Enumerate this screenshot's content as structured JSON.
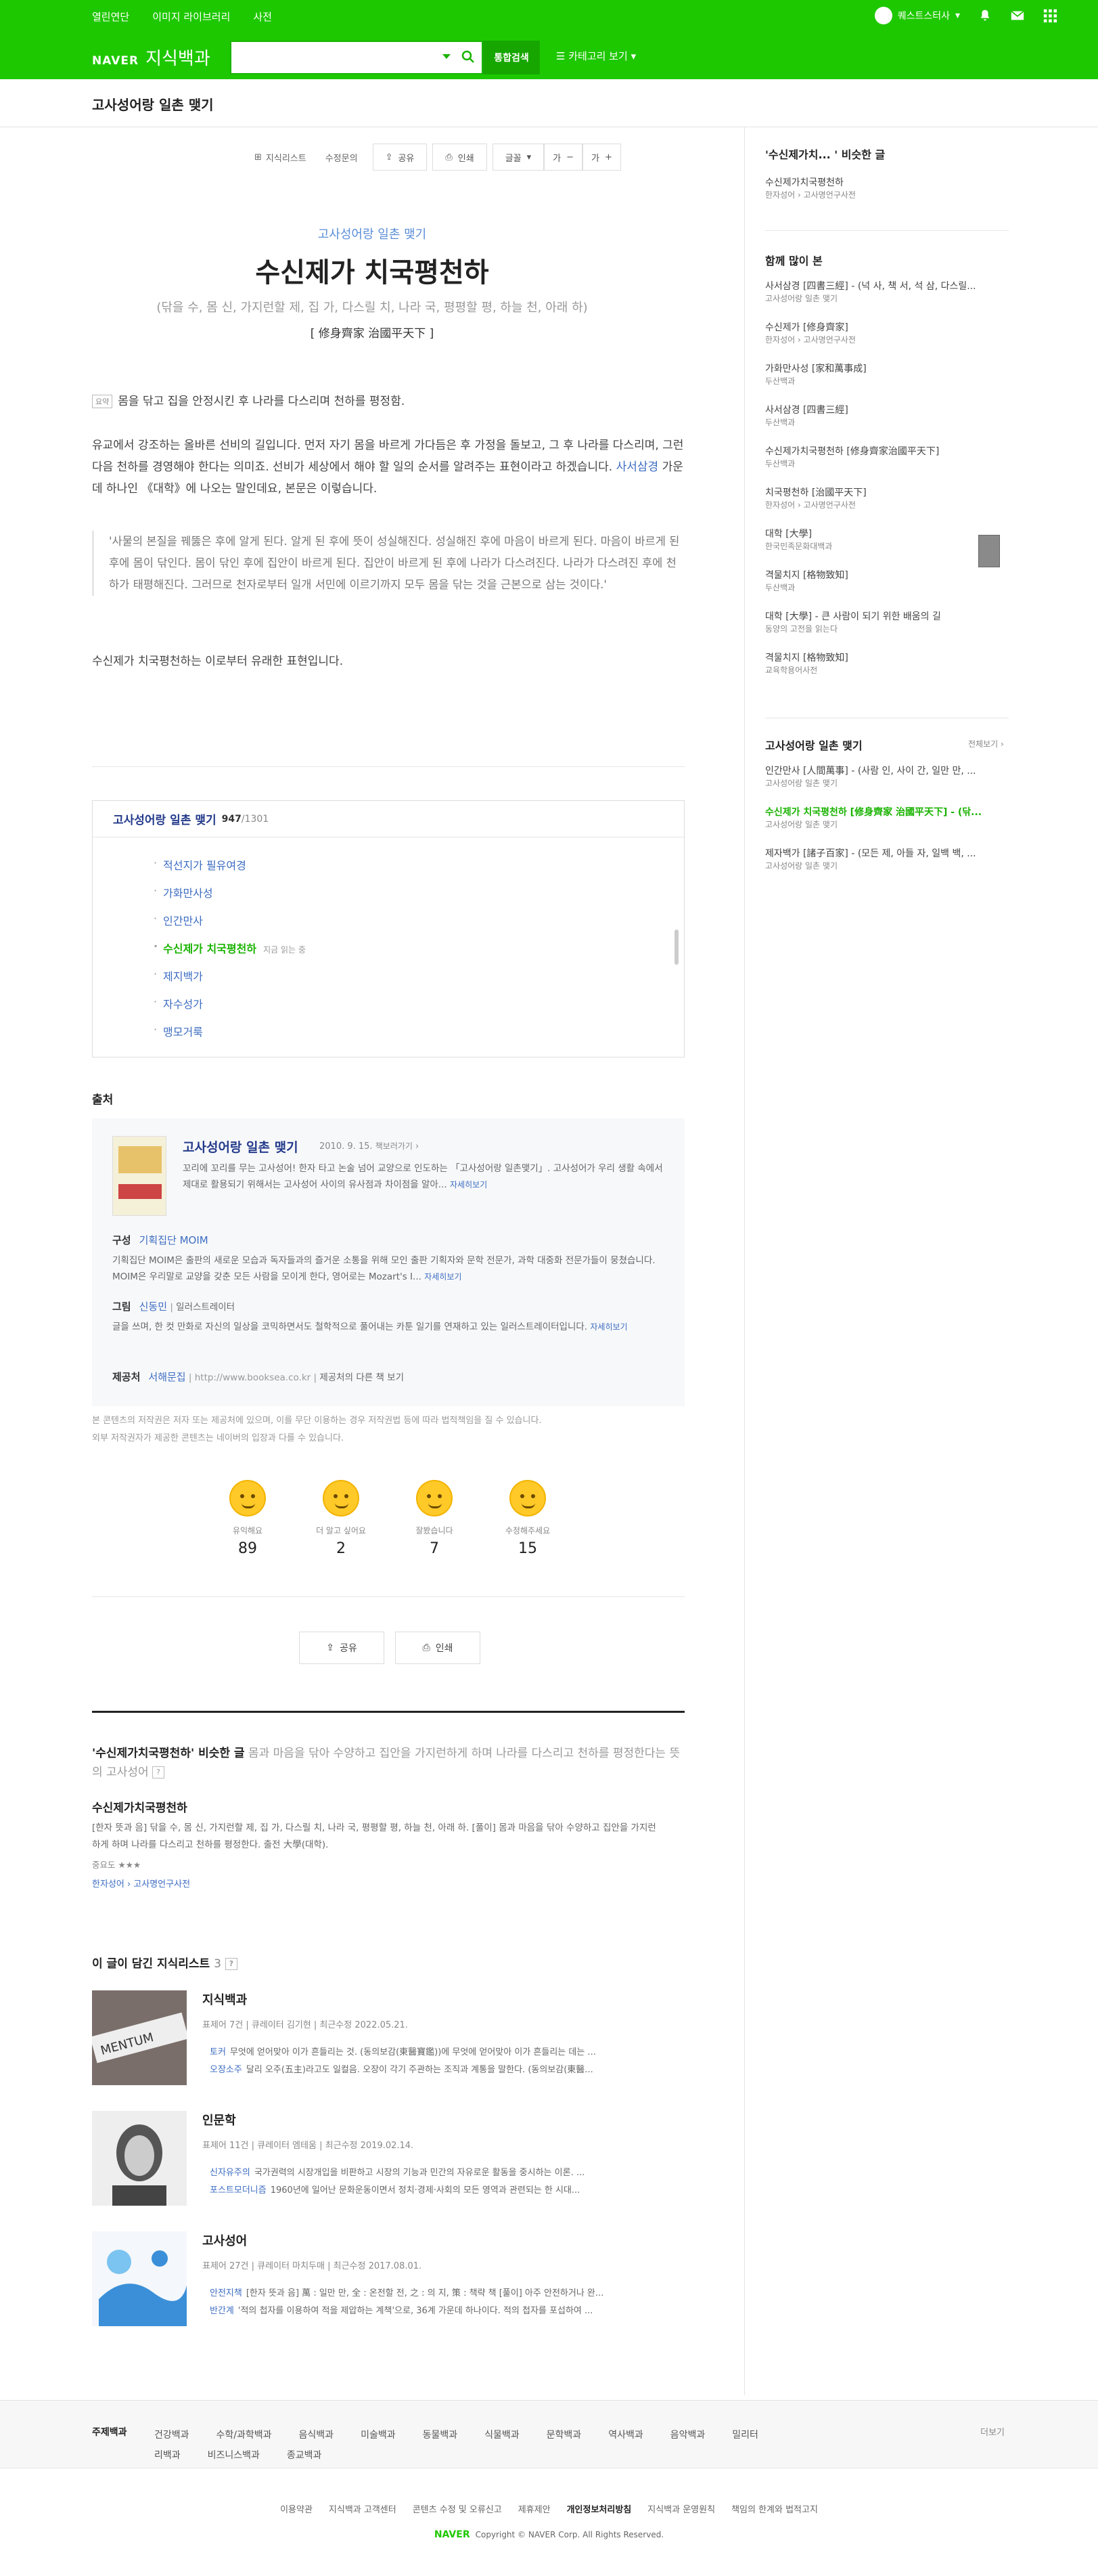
{
  "gnb": {
    "links": [
      "열린연단",
      "이미지 라이브러리",
      "사전"
    ],
    "user": "퀘스트스터사",
    "logo": "NAVER",
    "service": "지식백과",
    "search_btn": "통합검색",
    "category_btn": "카테고리 보기"
  },
  "page_title": "고사성어랑 일촌 맺기",
  "tools": {
    "knowledge_list": "지식리스트",
    "edit_request": "수정문의",
    "share": "공유",
    "print": "인쇄",
    "font": "글꼴",
    "font_small": "가",
    "font_large": "가"
  },
  "article": {
    "category": "고사성어랑 일촌 맺기",
    "headword": "수신제가 치국평천하",
    "reading": "(닦을 수, 몸 신, 가지런할 제, 집 가, 다스릴 치, 나라 국, 평평할 평, 하늘 천, 아래 하)",
    "hanja": "[ 修身齊家 治國平天下 ]",
    "summary_tag": "요약",
    "summary": "몸을 닦고 집을 안정시킨 후 나라를 다스리며 천하를 평정함.",
    "para1_a": "유교에서 강조하는 올바른 선비의 길입니다. 먼저 자기 몸을 바르게 가다듬은 후 가정을 돌보고, 그 후 나라를 다스리며, 그런 다음 천하를 경영해야 한다는 의미죠. 선비가 세상에서 해야 할 일의 순서를 알려주는 표현이라고 하겠습니다.",
    "para1_link": "사서삼경",
    "para1_b": " 가운데 하나인 《대학》에 나오는 말인데요, 본문은 이렇습니다.",
    "quote": "'사물의 본질을 꿰뚫은 후에 알게 된다. 알게 된 후에 뜻이 성실해진다. 성실해진 후에 마음이 바르게 된다. 마음이 바르게 된 후에 몸이 닦인다. 몸이 닦인 후에 집안이 바르게 된다. 집안이 바르게 된 후에 나라가 다스려진다. 나라가 다스려진 후에 천하가 태평해진다. 그러므로 천자로부터 일개 서민에 이르기까지 모두 몸을 닦는 것을 근본으로 삼는 것이다.'",
    "para2": "수신제가 치국평천하는 이로부터 유래한 표현입니다."
  },
  "toc": {
    "title": "고사성어랑 일촌 맺기",
    "current": "947",
    "total": "/1301",
    "items": [
      "적선지가 필유여경",
      "가화만사성",
      "인간만사",
      "수신제가 치국평천하",
      "제지백가",
      "자수성가",
      "맹모거룩"
    ],
    "now_label": "지금 읽는 중"
  },
  "source": {
    "heading": "출처",
    "book_title": "고사성어랑 일촌 맺기",
    "date": "2010. 9. 15.",
    "book_more": "책보러가기",
    "book_desc": "꼬리에 꼬리를 무는 고사성어! 한자 타고 논술 넘어 교양으로 인도하는 「고사성어랑 일촌맺기」. 고사성어가 우리 생활 속에서 제대로 활용되기 위해서는 고사성어 사이의 유사점과 차이점을 알아...",
    "more": "자세히보기",
    "composition_label": "구성",
    "composition": "기획집단 MOIM",
    "composition_desc": "기획집단 MOIM은 출판의 새로운 모습과 독자들과의 즐거운 소통을 위해 모인 출판 기획자와 문학 전문가, 과학 대중화 전문가들이 뭉쳤습니다. MOIM은 우리말로 교양을 갖춘 모든 사람을 모이게 한다, 영어로는 Mozart's I...",
    "illust_label": "그림",
    "illust": "신동민",
    "illust_role": "일러스트레이터",
    "illust_desc": "글을 쓰며, 한 컷 만화로 자신의 일상을 코믹하면서도 철학적으로 풀어내는 카툰 일기를 연재하고 있는 일러스트레이터입니다.",
    "provider_label": "제공처",
    "provider": "서해문집",
    "provider_url": "http://www.booksea.co.kr",
    "provider_more": "제공처의 다른 책 보기",
    "notice1": "본 콘텐츠의 저작권은 저자 또는 제공처에 있으며, 이를 무단 이용하는 경우 저작권법 등에 따라 법적책임을 질 수 있습니다.",
    "notice2": "외부 저작권자가 제공한 콘텐츠는 네이버의 입장과 다를 수 있습니다."
  },
  "reactions": [
    {
      "label": "유익해요",
      "count": "89"
    },
    {
      "label": "더 알고 싶어요",
      "count": "2"
    },
    {
      "label": "잘봤습니다",
      "count": "7"
    },
    {
      "label": "수정해주세요",
      "count": "15"
    }
  ],
  "bottom_tools": {
    "share": "공유",
    "print": "인쇄"
  },
  "similar": {
    "title": "'수신제가치국평천하' 비슷한 글",
    "desc": "몸과 마음을 닦아 수양하고 집안을 가지런하게 하며 나라를 다스리고 천하를 평정한다는 뜻의 고사성어",
    "q": "?",
    "item_title": "수신제가치국평천하",
    "item_desc": "[한자 뜻과 음] 닦을 수, 몸 신, 가지런할 제, 집 가, 다스릴 치, 나라 국, 평평할 평, 하늘 천, 아래 하. [풀이] 몸과 마음을 닦아 수양하고 집안을 가지런하게 하며 나라를 다스리고 천하를 평정한다. 출전 大學(대학).",
    "level_label": "중요도",
    "level": "★★★",
    "source": "한자성어 › 고사명언구사전"
  },
  "klists": {
    "heading": "이 글이 담긴 지식리스트",
    "count": "3",
    "items": [
      {
        "name": "지식백과",
        "meta": "표제어 7건  |  큐레이터 김기현  |  최근수정 2022.05.21.",
        "lines": [
          {
            "k": "토커",
            "t": "무엇에 얻어맞아 이가 흔들리는 것. (동의보감(東醫寶鑑))에 무엇에 얻어맞아 이가 흔들리는 데는 ..."
          },
          {
            "k": "오장소주",
            "t": "달리 오주(五主)라고도 일컬음. 오장이 각기 주관하는 조직과 계통을 말한다. (동의보감(東醫..."
          }
        ]
      },
      {
        "name": "인문학",
        "meta": "표제어 11건  |  큐레이터 엠테움  |  최근수정 2019.02.14.",
        "lines": [
          {
            "k": "신자유주의",
            "t": "국가권력의 시장개입을 비판하고 시장의 기능과 민간의 자유로운 활동을 중시하는 이론. ..."
          },
          {
            "k": "포스트모더니즘",
            "t": "1960년에 일어난 문화운동이면서 정치·경제·사회의 모든 영역과 관련되는 한 시대..."
          }
        ]
      },
      {
        "name": "고사성어",
        "meta": "표제어 27건  |  큐레이터 마치두매  |  최근수정 2017.08.01.",
        "lines": [
          {
            "k": "안전지책",
            "t": "[한자 뜻과 음] 萬 : 일만 만, 全 : 온전할 전, 之 : 의 지, 策 : 책략 책 [풀이] 아주 안전하거나 완..."
          },
          {
            "k": "반간계",
            "t": "'적의 첩자를 이용하여 적을 제압하는 계책'으로, 36계 가운데 하나이다. 적의 첩자를 포섭하여 ..."
          }
        ]
      }
    ]
  },
  "sidebar": {
    "similar_title": "'수신제가치... ' 비슷한 글",
    "similar_items": [
      {
        "t": "수신제가치국평천하",
        "s": "한자성어 › 고사명언구사전"
      }
    ],
    "popular_title": "함께 많이 본",
    "popular": [
      {
        "t": "사서삼경 [四書三經] - (넉 사, 책 서, 석 삼, 다스릴...",
        "s": "고사성어랑 일촌 맺기"
      },
      {
        "t": "수신제가 [修身齊家]",
        "s": "한자성어 › 고사명언구사전"
      },
      {
        "t": "가화만사성 [家和萬事成]",
        "s": "두산백과"
      },
      {
        "t": "사서삼경 [四書三經]",
        "s": "두산백과"
      },
      {
        "t": "수신제가치국평천하 [修身齊家治國平天下]",
        "s": "두산백과"
      },
      {
        "t": "치국평천하 [治國平天下]",
        "s": "한자성어 › 고사명언구사전"
      },
      {
        "t": "대학 [大學]",
        "s": "한국민족문화대백과"
      },
      {
        "t": "격물치지 [格物致知]",
        "s": "두산백과"
      },
      {
        "t": "대학 [大學] - 큰 사람이 되기 위한 배움의 길",
        "s": "동양의 고전을 읽는다"
      },
      {
        "t": "격물치지 [格物致知]",
        "s": "교육학용어사전"
      }
    ],
    "toc_title": "고사성어랑 일촌 맺기",
    "toc_more": "전체보기",
    "toc_items": [
      {
        "t": "인간만사 [人間萬事] - (사람 인, 사이 간, 일만 만, ...",
        "s": "고사성어랑 일촌 맺기",
        "cur": false
      },
      {
        "t": "수신제가 치국평천하 [修身齊家 治國平天下] - (닦...",
        "s": "고사성어랑 일촌 맺기",
        "cur": true
      },
      {
        "t": "제자백가 [諸子百家] - (모든 제, 아들 자, 일백 백, ...",
        "s": "고사성어랑 일촌 맺기",
        "cur": false
      }
    ]
  },
  "footer": {
    "label": "주제백과",
    "cats": [
      "건강백과",
      "수학/과학백과",
      "음식백과",
      "미술백과",
      "동물백과",
      "식물백과",
      "문학백과",
      "역사백과",
      "음악백과",
      "밀리터리백과",
      "비즈니스백과",
      "종교백과"
    ],
    "more": "더보기",
    "links": [
      "이용약관",
      "지식백과 고객센터",
      "콘텐츠 수정 및 오류신고",
      "제휴제안",
      "개인정보처리방침",
      "지식백과 운영원칙",
      "책임의 한계와 법적고지"
    ],
    "bold_link": "개인정보처리방침",
    "brand": "NAVER",
    "copyright": "Copyright © NAVER Corp. All Rights Reserved."
  },
  "colors": {
    "brand": "#1ec800",
    "link": "#3d6dc2",
    "title_blue": "#233a8a"
  }
}
